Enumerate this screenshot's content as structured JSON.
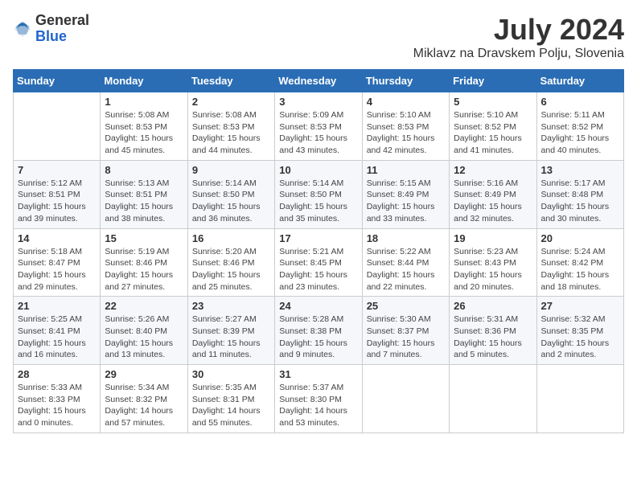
{
  "logo": {
    "general": "General",
    "blue": "Blue"
  },
  "title": "July 2024",
  "subtitle": "Miklavz na Dravskem Polju, Slovenia",
  "days_of_week": [
    "Sunday",
    "Monday",
    "Tuesday",
    "Wednesday",
    "Thursday",
    "Friday",
    "Saturday"
  ],
  "weeks": [
    [
      {
        "day": "",
        "sunrise": "",
        "sunset": "",
        "daylight": ""
      },
      {
        "day": "1",
        "sunrise": "Sunrise: 5:08 AM",
        "sunset": "Sunset: 8:53 PM",
        "daylight": "Daylight: 15 hours and 45 minutes."
      },
      {
        "day": "2",
        "sunrise": "Sunrise: 5:08 AM",
        "sunset": "Sunset: 8:53 PM",
        "daylight": "Daylight: 15 hours and 44 minutes."
      },
      {
        "day": "3",
        "sunrise": "Sunrise: 5:09 AM",
        "sunset": "Sunset: 8:53 PM",
        "daylight": "Daylight: 15 hours and 43 minutes."
      },
      {
        "day": "4",
        "sunrise": "Sunrise: 5:10 AM",
        "sunset": "Sunset: 8:53 PM",
        "daylight": "Daylight: 15 hours and 42 minutes."
      },
      {
        "day": "5",
        "sunrise": "Sunrise: 5:10 AM",
        "sunset": "Sunset: 8:52 PM",
        "daylight": "Daylight: 15 hours and 41 minutes."
      },
      {
        "day": "6",
        "sunrise": "Sunrise: 5:11 AM",
        "sunset": "Sunset: 8:52 PM",
        "daylight": "Daylight: 15 hours and 40 minutes."
      }
    ],
    [
      {
        "day": "7",
        "sunrise": "Sunrise: 5:12 AM",
        "sunset": "Sunset: 8:51 PM",
        "daylight": "Daylight: 15 hours and 39 minutes."
      },
      {
        "day": "8",
        "sunrise": "Sunrise: 5:13 AM",
        "sunset": "Sunset: 8:51 PM",
        "daylight": "Daylight: 15 hours and 38 minutes."
      },
      {
        "day": "9",
        "sunrise": "Sunrise: 5:14 AM",
        "sunset": "Sunset: 8:50 PM",
        "daylight": "Daylight: 15 hours and 36 minutes."
      },
      {
        "day": "10",
        "sunrise": "Sunrise: 5:14 AM",
        "sunset": "Sunset: 8:50 PM",
        "daylight": "Daylight: 15 hours and 35 minutes."
      },
      {
        "day": "11",
        "sunrise": "Sunrise: 5:15 AM",
        "sunset": "Sunset: 8:49 PM",
        "daylight": "Daylight: 15 hours and 33 minutes."
      },
      {
        "day": "12",
        "sunrise": "Sunrise: 5:16 AM",
        "sunset": "Sunset: 8:49 PM",
        "daylight": "Daylight: 15 hours and 32 minutes."
      },
      {
        "day": "13",
        "sunrise": "Sunrise: 5:17 AM",
        "sunset": "Sunset: 8:48 PM",
        "daylight": "Daylight: 15 hours and 30 minutes."
      }
    ],
    [
      {
        "day": "14",
        "sunrise": "Sunrise: 5:18 AM",
        "sunset": "Sunset: 8:47 PM",
        "daylight": "Daylight: 15 hours and 29 minutes."
      },
      {
        "day": "15",
        "sunrise": "Sunrise: 5:19 AM",
        "sunset": "Sunset: 8:46 PM",
        "daylight": "Daylight: 15 hours and 27 minutes."
      },
      {
        "day": "16",
        "sunrise": "Sunrise: 5:20 AM",
        "sunset": "Sunset: 8:46 PM",
        "daylight": "Daylight: 15 hours and 25 minutes."
      },
      {
        "day": "17",
        "sunrise": "Sunrise: 5:21 AM",
        "sunset": "Sunset: 8:45 PM",
        "daylight": "Daylight: 15 hours and 23 minutes."
      },
      {
        "day": "18",
        "sunrise": "Sunrise: 5:22 AM",
        "sunset": "Sunset: 8:44 PM",
        "daylight": "Daylight: 15 hours and 22 minutes."
      },
      {
        "day": "19",
        "sunrise": "Sunrise: 5:23 AM",
        "sunset": "Sunset: 8:43 PM",
        "daylight": "Daylight: 15 hours and 20 minutes."
      },
      {
        "day": "20",
        "sunrise": "Sunrise: 5:24 AM",
        "sunset": "Sunset: 8:42 PM",
        "daylight": "Daylight: 15 hours and 18 minutes."
      }
    ],
    [
      {
        "day": "21",
        "sunrise": "Sunrise: 5:25 AM",
        "sunset": "Sunset: 8:41 PM",
        "daylight": "Daylight: 15 hours and 16 minutes."
      },
      {
        "day": "22",
        "sunrise": "Sunrise: 5:26 AM",
        "sunset": "Sunset: 8:40 PM",
        "daylight": "Daylight: 15 hours and 13 minutes."
      },
      {
        "day": "23",
        "sunrise": "Sunrise: 5:27 AM",
        "sunset": "Sunset: 8:39 PM",
        "daylight": "Daylight: 15 hours and 11 minutes."
      },
      {
        "day": "24",
        "sunrise": "Sunrise: 5:28 AM",
        "sunset": "Sunset: 8:38 PM",
        "daylight": "Daylight: 15 hours and 9 minutes."
      },
      {
        "day": "25",
        "sunrise": "Sunrise: 5:30 AM",
        "sunset": "Sunset: 8:37 PM",
        "daylight": "Daylight: 15 hours and 7 minutes."
      },
      {
        "day": "26",
        "sunrise": "Sunrise: 5:31 AM",
        "sunset": "Sunset: 8:36 PM",
        "daylight": "Daylight: 15 hours and 5 minutes."
      },
      {
        "day": "27",
        "sunrise": "Sunrise: 5:32 AM",
        "sunset": "Sunset: 8:35 PM",
        "daylight": "Daylight: 15 hours and 2 minutes."
      }
    ],
    [
      {
        "day": "28",
        "sunrise": "Sunrise: 5:33 AM",
        "sunset": "Sunset: 8:33 PM",
        "daylight": "Daylight: 15 hours and 0 minutes."
      },
      {
        "day": "29",
        "sunrise": "Sunrise: 5:34 AM",
        "sunset": "Sunset: 8:32 PM",
        "daylight": "Daylight: 14 hours and 57 minutes."
      },
      {
        "day": "30",
        "sunrise": "Sunrise: 5:35 AM",
        "sunset": "Sunset: 8:31 PM",
        "daylight": "Daylight: 14 hours and 55 minutes."
      },
      {
        "day": "31",
        "sunrise": "Sunrise: 5:37 AM",
        "sunset": "Sunset: 8:30 PM",
        "daylight": "Daylight: 14 hours and 53 minutes."
      },
      {
        "day": "",
        "sunrise": "",
        "sunset": "",
        "daylight": ""
      },
      {
        "day": "",
        "sunrise": "",
        "sunset": "",
        "daylight": ""
      },
      {
        "day": "",
        "sunrise": "",
        "sunset": "",
        "daylight": ""
      }
    ]
  ]
}
